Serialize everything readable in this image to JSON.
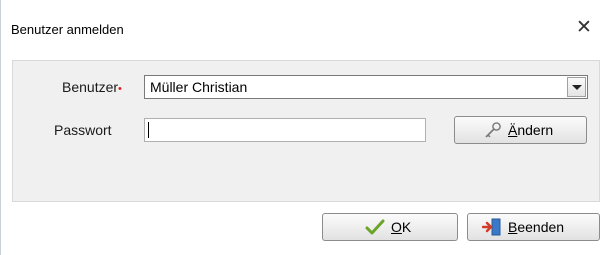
{
  "window": {
    "title": "Benutzer anmelden",
    "close_glyph": "✕"
  },
  "form": {
    "user_label": "Benutzer",
    "required_marker": "•",
    "user_value": "Müller Christian",
    "password_label": "Passwort",
    "password_value": ""
  },
  "buttons": {
    "change": {
      "mnemonic": "Ä",
      "rest": "ndern",
      "icon": "key-icon"
    },
    "ok": {
      "mnemonic": "O",
      "rest": "K",
      "icon": "checkmark-icon"
    },
    "exit": {
      "mnemonic": "B",
      "rest": "eenden",
      "icon": "exit-door-icon"
    }
  },
  "colors": {
    "required": "#e02020",
    "check_green": "#6aa52a",
    "exit_red": "#d23a2a",
    "exit_blue": "#3a78c8"
  }
}
